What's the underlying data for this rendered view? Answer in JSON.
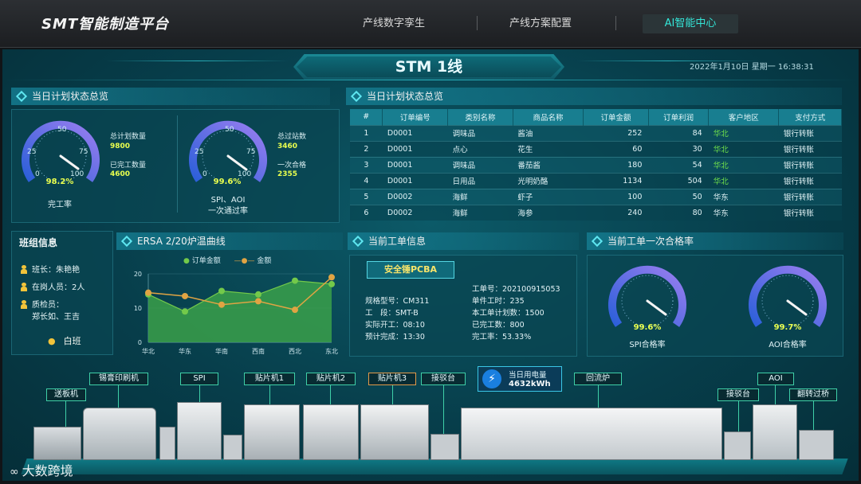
{
  "app": {
    "brand": "SMT智能制造平台"
  },
  "nav": {
    "tabs": [
      {
        "label": "产线数字孪生",
        "active": false
      },
      {
        "label": "产线方案配置",
        "active": false
      },
      {
        "label": "AI智能中心",
        "active": true
      }
    ]
  },
  "screen": {
    "title": "STM 1线",
    "datetime": "2022年1月10日 星期一    16:38:31"
  },
  "plan_status": {
    "title": "当日计划状态总览",
    "gauge1": {
      "value_label": "98.2%",
      "value": 98.2,
      "name": "完工率",
      "ticks": [
        "0",
        "25",
        "50",
        "75",
        "100"
      ]
    },
    "gauge2": {
      "value_label": "99.6%",
      "value": 99.6,
      "name": "SPI、AOI",
      "name2": "一次通过率",
      "ticks": [
        "0",
        "25",
        "50",
        "75",
        "100"
      ]
    },
    "planned_qty_label": "总计划数量",
    "planned_qty": "9800",
    "done_qty_label": "已完工数量",
    "done_qty": "4600",
    "total_points_label": "总过站数",
    "total_points": "3460",
    "pass_once_label": "一次合格",
    "pass_once": "2355"
  },
  "orders": {
    "title": "当日计划状态总览",
    "headers": [
      "#",
      "订单编号",
      "类别名称",
      "商品名称",
      "订单金额",
      "订单利润",
      "客户地区",
      "支付方式"
    ],
    "rows": [
      [
        "1",
        "D0001",
        "调味品",
        "酱油",
        "252",
        "84",
        "华北",
        "银行转账"
      ],
      [
        "2",
        "D0001",
        "点心",
        "花生",
        "60",
        "30",
        "华北",
        "银行转账"
      ],
      [
        "3",
        "D0001",
        "调味品",
        "番茄酱",
        "180",
        "54",
        "华北",
        "银行转账"
      ],
      [
        "4",
        "D0001",
        "日用品",
        "光明奶酪",
        "1134",
        "504",
        "华北",
        "银行转账"
      ],
      [
        "5",
        "D0002",
        "海鲜",
        "虾子",
        "100",
        "50",
        "华东",
        "银行转账"
      ],
      [
        "6",
        "D0002",
        "海鲜",
        "海参",
        "240",
        "80",
        "华东",
        "银行转账"
      ]
    ]
  },
  "team": {
    "title": "班组信息",
    "leader": "班长：朱艳艳",
    "staff": "在岗人员：2人",
    "inspector": "质检员：",
    "inspector_names": "郑长如、王吉",
    "shift": "白班"
  },
  "temp_chart": {
    "title": "ERSA 2/20炉温曲线",
    "legend": [
      "订单金额",
      "金额"
    ]
  },
  "chart_data": {
    "type": "area",
    "categories": [
      "华北",
      "华东",
      "华南",
      "西南",
      "西北",
      "东北"
    ],
    "series": [
      {
        "name": "订单金额",
        "values": [
          14,
          9,
          15,
          14,
          18,
          17
        ]
      },
      {
        "name": "金额",
        "values": [
          14.5,
          13.5,
          11,
          12,
          9.5,
          19
        ]
      }
    ],
    "yticks": [
      "0",
      "10",
      "20"
    ],
    "ylim": [
      0,
      20
    ],
    "colors": {
      "area": "#3aa04a",
      "area_pt": "#73c94a",
      "line2": "#e0a443"
    }
  },
  "work_order": {
    "title": "当前工单信息",
    "product": "安全锤PCBA",
    "model": "规格型号：CM311",
    "section": "工　段：SMT-B",
    "start": "实际开工：08:10",
    "finish": "预计完成：13:30",
    "order_no": "工单号：202100915053",
    "unit_time": "单件工时：235",
    "planned": "本工单计划数：1500",
    "done": "已完工数：800",
    "rate": "完工率：53.33%"
  },
  "pass_rate": {
    "title": "当前工单一次合格率",
    "spi": {
      "value_label": "99.6%",
      "value": 99.6,
      "name": "SPI合格率"
    },
    "aoi": {
      "value_label": "99.7%",
      "value": 99.7,
      "name": "AOI合格率"
    }
  },
  "line": {
    "stations": [
      "送板机",
      "锡膏印刷机",
      "SPI",
      "贴片机1",
      "贴片机2",
      "贴片机3",
      "接驳台",
      "回流炉",
      "接驳台",
      "AOI",
      "翻转过桥"
    ],
    "power_label": "当日用电量",
    "power_value": "4632kWh"
  },
  "watermark": "大数跨境"
}
